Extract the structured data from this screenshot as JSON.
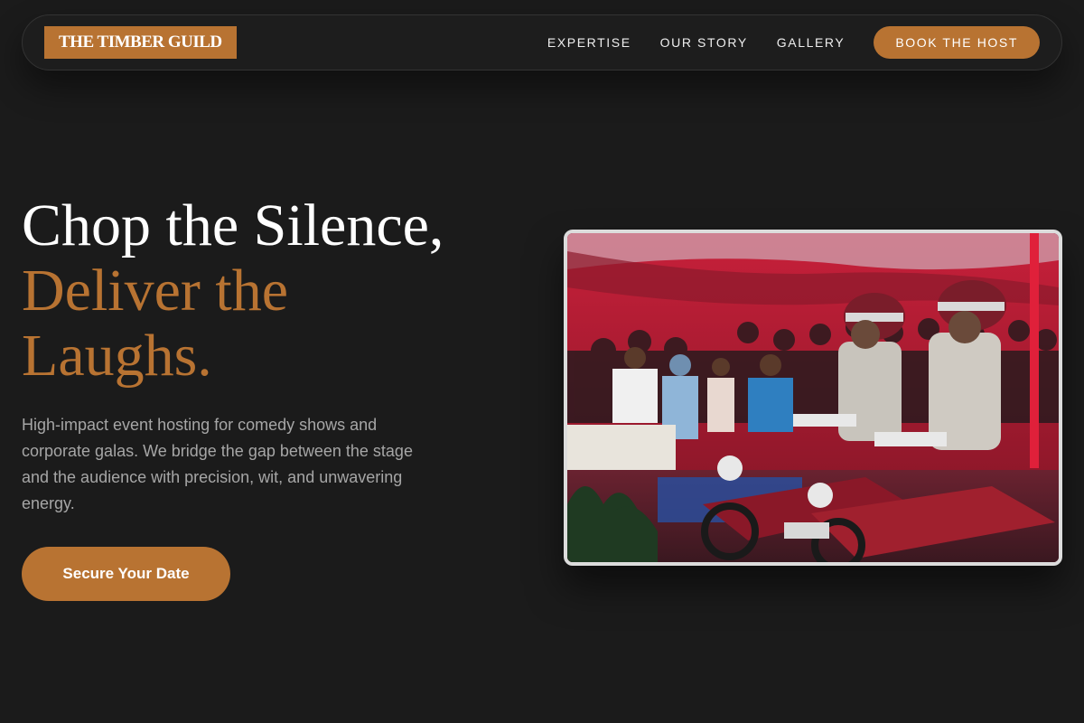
{
  "brand": {
    "logo_text": "THE TIMBER GUILD"
  },
  "nav": {
    "links": [
      "EXPERTISE",
      "OUR STORY",
      "GALLERY"
    ],
    "cta_label": "BOOK THE HOST"
  },
  "hero": {
    "title_line1": "Chop the Silence,",
    "title_line2": "Deliver the",
    "title_line3": "Laughs.",
    "description": "High-impact event hosting for comedy shows and corporate galas. We bridge the gap between the stage and the audience with precision, wit, and unwavering energy.",
    "cta_label": "Secure Your Date"
  },
  "photo": {
    "subject": "Two helmeted uniformed officers riding motorcycles past a seated audience under a red tent"
  },
  "colors": {
    "background": "#1b1b1b",
    "accent": "#b87332",
    "text_primary": "#ffffff",
    "text_muted": "#a6a6a6"
  }
}
